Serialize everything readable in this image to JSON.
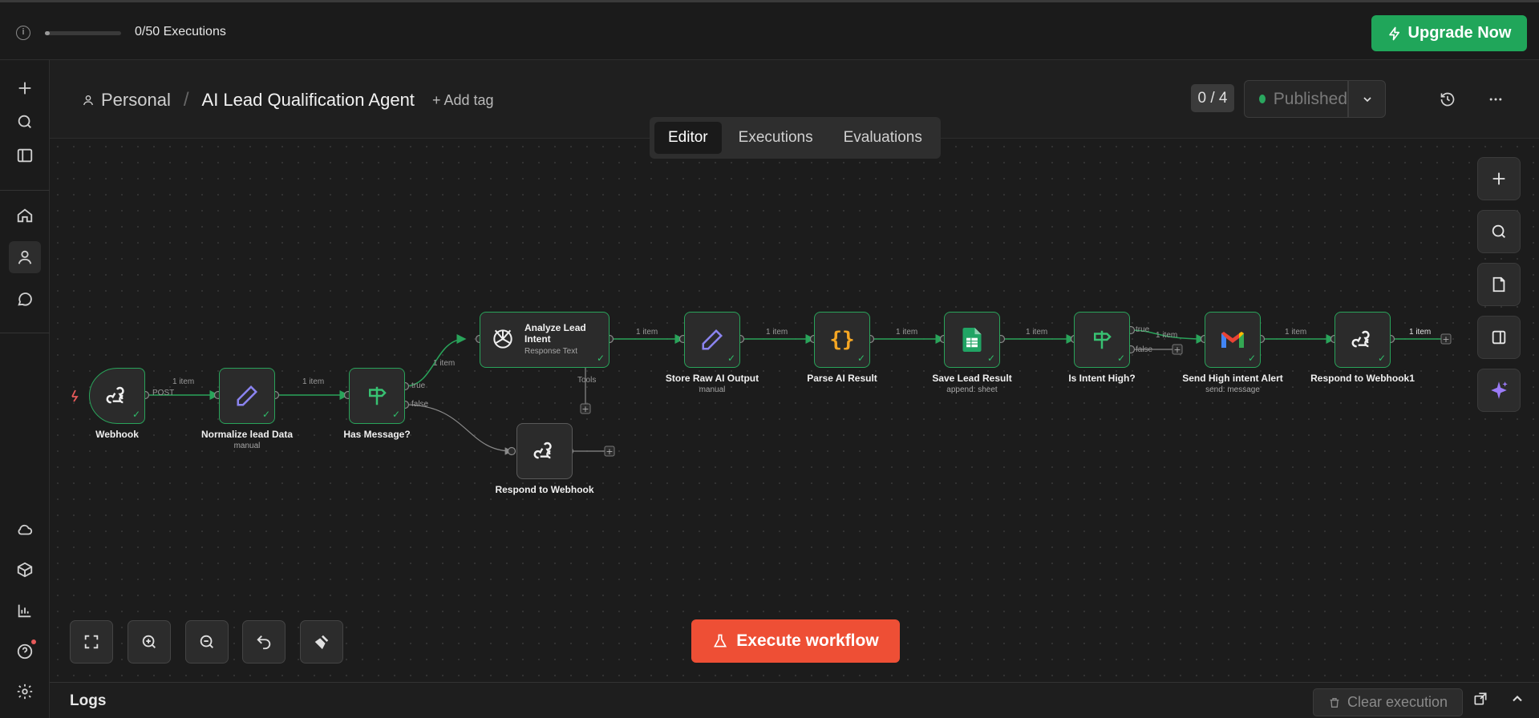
{
  "topbar": {
    "executions_label": "0/50 Executions",
    "executions_used": 0,
    "executions_limit": 50,
    "info_icon": "info-icon",
    "upgrade_label": "Upgrade Now"
  },
  "header": {
    "project": "Personal",
    "workflow_name": "AI Lead Qualification Agent",
    "add_tag": "+ Add tag",
    "version_counter": "0 / 4",
    "publish_status": "Published"
  },
  "tabs": [
    "Editor",
    "Executions",
    "Evaluations"
  ],
  "active_tab": "Editor",
  "nodes": {
    "webhook": {
      "label": "Webhook"
    },
    "normalize": {
      "label": "Normalize lead Data",
      "sub": "manual"
    },
    "has_message": {
      "label": "Has Message?"
    },
    "analyze": {
      "label": "Analyze Lead Intent",
      "sub": "Response Text"
    },
    "respond_webhook": {
      "label": "Respond to Webhook"
    },
    "store_raw": {
      "label": "Store Raw AI Output",
      "sub": "manual"
    },
    "parse": {
      "label": "Parse AI Result"
    },
    "save_lead": {
      "label": "Save Lead Result",
      "sub": "append: sheet"
    },
    "intent_high": {
      "label": "Is Intent High?"
    },
    "send_alert": {
      "label": "Send High intent Alert",
      "sub": "send: message"
    },
    "respond_webhook1": {
      "label": "Respond to Webhook1"
    }
  },
  "edges": {
    "post": "POST",
    "item": "1 item",
    "true": "true",
    "false": "false",
    "tools": "Tools"
  },
  "execute_label": "Execute workflow",
  "logs": {
    "title": "Logs",
    "clear_label": "Clear execution"
  },
  "colors": {
    "accent_green": "#29a35a",
    "execute_red": "#ee4f35",
    "upgrade_green": "#20a65a"
  }
}
